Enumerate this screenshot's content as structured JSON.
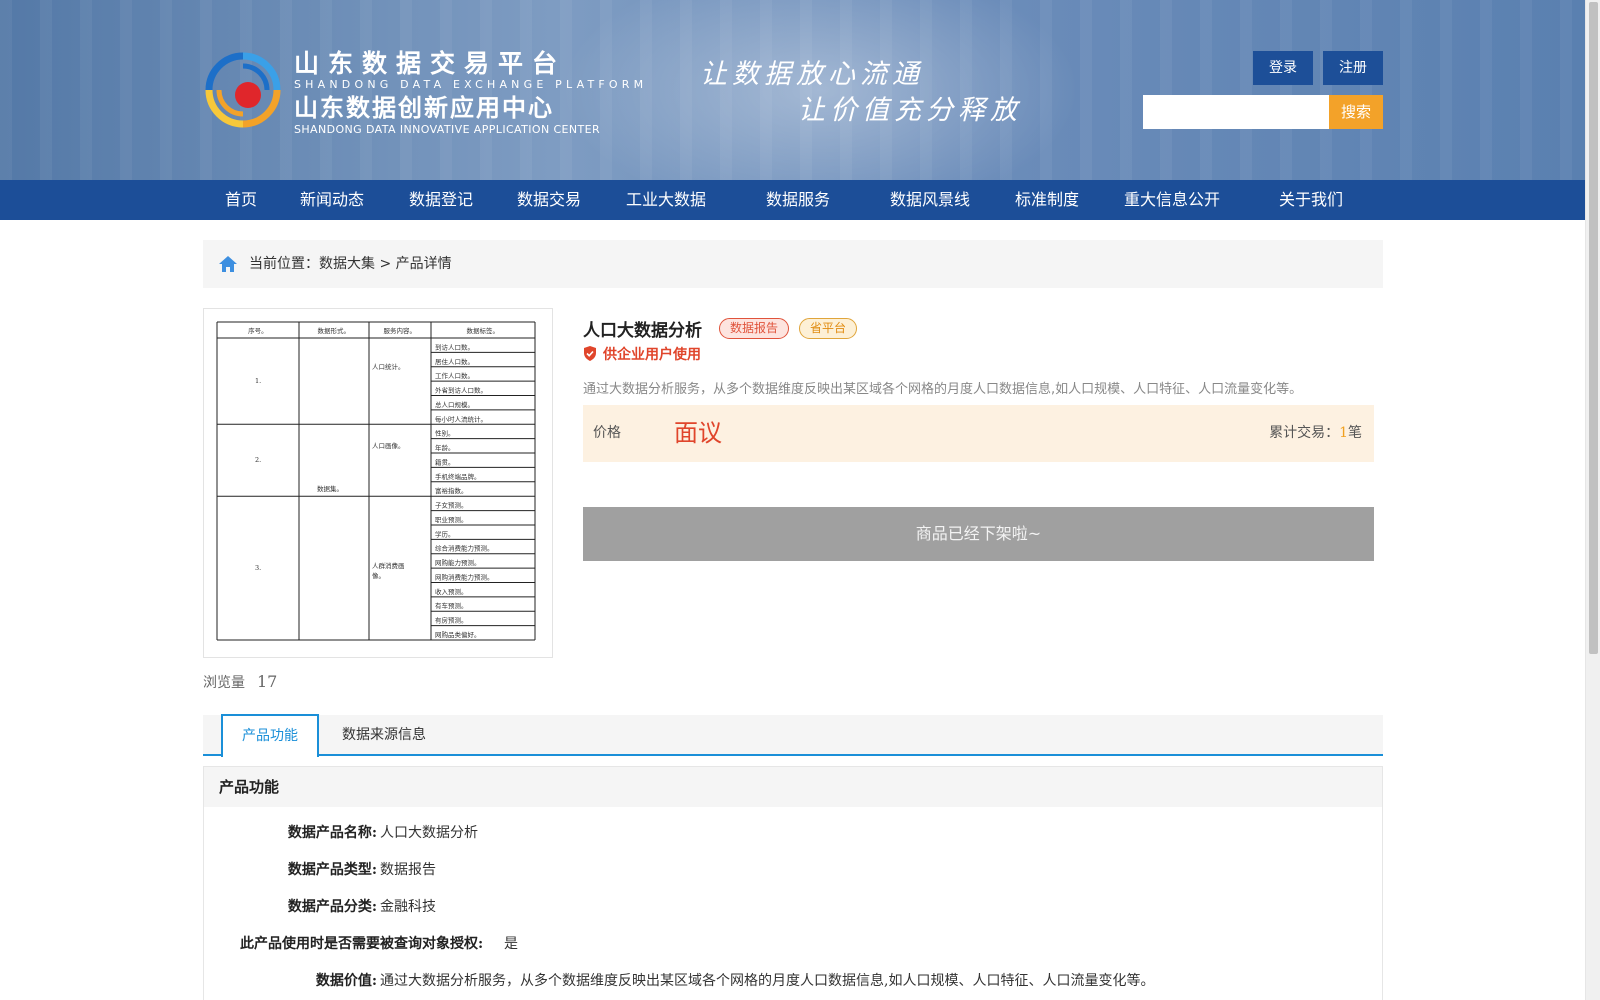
{
  "header": {
    "logo": {
      "name_cn": "山东数据交易平台",
      "name_en": "SHANDONG DATA EXCHANGE PLATFORM",
      "sub_cn": "山东数据创新应用中心",
      "sub_en": "SHANDONG DATA INNOVATIVE APPLICATION CENTER"
    },
    "slogan_line1": "让数据放心流通",
    "slogan_line2": "让价值充分释放",
    "login_label": "登录",
    "register_label": "注册",
    "search_placeholder": "",
    "search_label": "搜索"
  },
  "nav": {
    "items": [
      "首页",
      "新闻动态",
      "数据登记",
      "数据交易",
      "工业大数据",
      "数据服务",
      "数据风景线",
      "标准制度",
      "重大信息公开",
      "关于我们"
    ]
  },
  "breadcrumb": {
    "text": "当前位置：数据大集 > 产品详情"
  },
  "product": {
    "title": "人口大数据分析",
    "tag_type": "数据报告",
    "tag_platform": "省平台",
    "enterprise_only": "供企业用户使用",
    "description": "通过大数据分析服务，从多个数据维度反映出某区域各个网格的月度人口数据信息,如人口规模、人口特征、人口流量变化等。",
    "price_label": "价格",
    "price_value": "面议",
    "deals_label": "累计交易：",
    "deals_count": "1",
    "deals_unit": "笔",
    "offline_notice": "商品已经下架啦~",
    "views_label": "浏览量",
    "views_count": "17"
  },
  "thumbnail_table": {
    "headers": [
      "序号。",
      "数据形式。",
      "服务内容。",
      "数据标签。"
    ],
    "groups": [
      {
        "index": "1.",
        "content": "人口统计。",
        "labels": [
          "到访人口数。",
          "居住人口数。",
          "工作人口数。",
          "外省到访人口数。",
          "总人口规模。",
          "每小时人流统计。"
        ]
      },
      {
        "index": "2.",
        "content": "人口画像。",
        "labels": [
          "性别。",
          "年龄。",
          "籍贯。",
          "手机终端品牌。",
          "富裕指数。"
        ]
      },
      {
        "index": "3.",
        "content": "人群消费画像。",
        "labels": [
          "子女预测。",
          "职业预测。",
          "学历。",
          "综合消费能力预测。",
          "网购能力预测。",
          "网购消费能力预测。",
          "收入预测。",
          "有车预测。",
          "有房预测。",
          "网购品类偏好。"
        ]
      }
    ],
    "form": "数据集。"
  },
  "tabs": [
    "产品功能",
    "数据来源信息"
  ],
  "panel": {
    "title": "产品功能",
    "rows": [
      {
        "key": "数据产品名称:",
        "value": "人口大数据分析"
      },
      {
        "key": "数据产品类型:",
        "value": "数据报告"
      },
      {
        "key": "数据产品分类:",
        "value": "金融科技"
      },
      {
        "key": "此产品使用时是否需要被查询对象授权:",
        "value": "是"
      },
      {
        "key": "数据价值:",
        "value": "通过大数据分析服务，从多个数据维度反映出某区域各个网格的月度人口数据信息,如人口规模、人口特征、人口流量变化等。"
      }
    ]
  },
  "colors": {
    "nav_bg": "#1c4e98",
    "accent_orange": "#f3a229",
    "tab_blue": "#1a8fd8",
    "price_red": "#e0452b"
  }
}
